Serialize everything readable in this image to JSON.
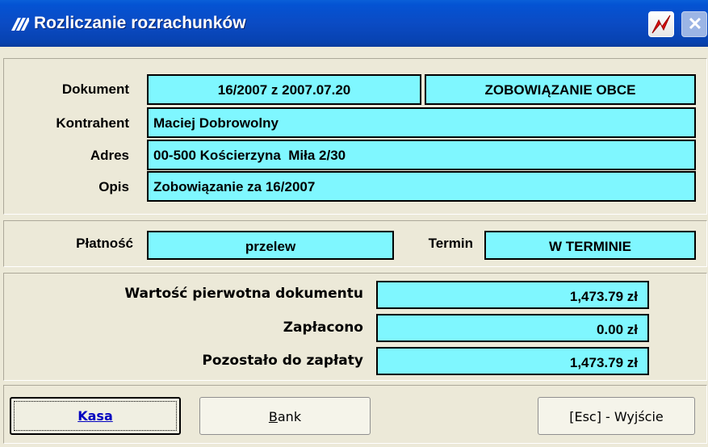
{
  "window": {
    "title": "Rozliczanie rozrachunków"
  },
  "document": {
    "label": "Dokument",
    "number": "16/2007 z 2007.07.20",
    "type": "ZOBOWIĄZANIE OBCE"
  },
  "contractor": {
    "label": "Kontrahent",
    "value": "Maciej Dobrowolny"
  },
  "address": {
    "label": "Adres",
    "value": "00-500 Kościerzyna  Miła 2/30"
  },
  "description": {
    "label": "Opis",
    "value": "Zobowiązanie za 16/2007"
  },
  "payment": {
    "label": "Płatność",
    "value": "przelew",
    "term_label": "Termin",
    "term_value": "W TERMINIE"
  },
  "amounts": {
    "original_label": "Wartość pierwotna dokumentu",
    "original_value": "1,473.79 zł",
    "paid_label": "Zapłacono",
    "paid_value": "0.00 zł",
    "remaining_label": "Pozostało do zapłaty",
    "remaining_value": "1,473.79 zł"
  },
  "buttons": {
    "kasa": "Kasa",
    "bank_underlined": "B",
    "bank_rest": "ank",
    "exit": "[Esc] - Wyjście"
  },
  "colors": {
    "field_bg": "#7ff7ff",
    "titlebar": "#0b4bc4",
    "kasa_text": "#0000c0"
  }
}
